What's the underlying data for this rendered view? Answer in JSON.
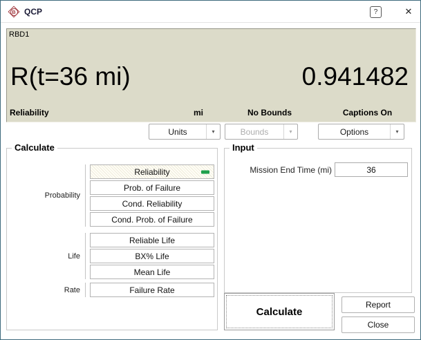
{
  "window": {
    "title": "QCP",
    "icons": {
      "app": "B",
      "help": "?",
      "close": "✕",
      "dropdown_arrow": "▾"
    }
  },
  "result_panel": {
    "model_name": "RBD1",
    "expression": "R(t=36 mi)",
    "value": "0.941482",
    "metric_label": "Reliability",
    "units_label": "mi",
    "bounds_label": "No Bounds",
    "captions_label": "Captions On",
    "background_color": "#dcdbc9"
  },
  "toolbar": {
    "units_label": "Units",
    "bounds_label": "Bounds",
    "bounds_enabled": false,
    "options_label": "Options"
  },
  "calculate_group": {
    "title": "Calculate",
    "clusters": [
      {
        "label": "Probability",
        "buttons": [
          "Reliability",
          "Prob. of Failure",
          "Cond. Reliability",
          "Cond. Prob. of Failure"
        ]
      },
      {
        "label": "Life",
        "buttons": [
          "Reliable Life",
          "BX% Life",
          "Mean Life"
        ]
      },
      {
        "label": "Rate",
        "buttons": [
          "Failure Rate"
        ]
      }
    ],
    "selected_button": "Reliability",
    "selected_indicator_color": "#1fa04c"
  },
  "input_group": {
    "title": "Input",
    "field_label": "Mission End Time (mi)",
    "field_value": "36"
  },
  "actions": {
    "calculate_label": "Calculate",
    "report_label": "Report",
    "close_label": "Close"
  }
}
